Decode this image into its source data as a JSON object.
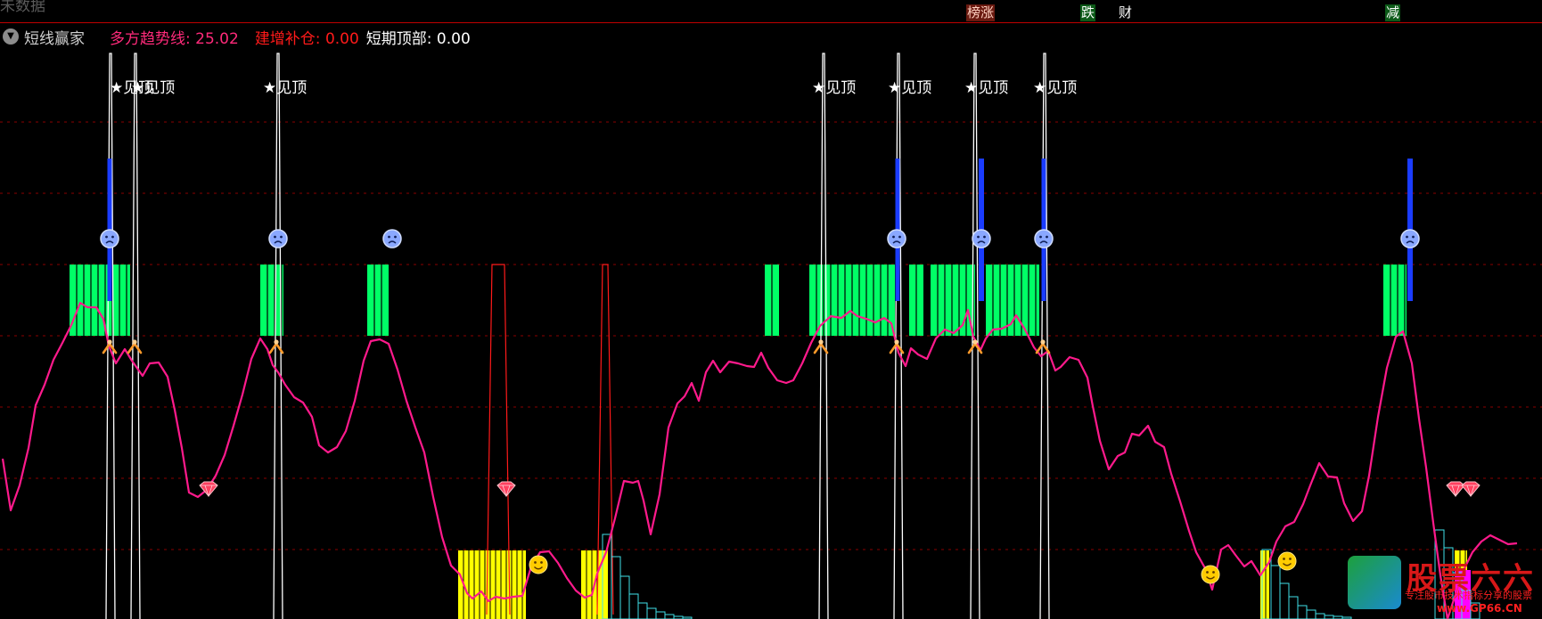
{
  "header": {
    "ghost_text_a": "",
    "ghost_text_b": "未数据",
    "tags": [
      {
        "label": "榜涨"
      },
      {
        "label": "跌"
      },
      {
        "label": "财"
      },
      {
        "label": "减"
      }
    ]
  },
  "indicator": {
    "name": "短线赢家",
    "trend_label": "多方趋势线: 25.02",
    "add_label": "建增补仓: 0.00",
    "top_label": "短期顶部: 0.00"
  },
  "annotations": {
    "top_signal_text": "★见顶",
    "top_signal_x": [
      136,
      160,
      308,
      924,
      1009,
      1095,
      1172
    ]
  },
  "watermark": {
    "main": "股票六六",
    "sub": "专注股市技术指标分享的股票",
    "url": "www.GP66.CN"
  },
  "colors": {
    "trend_line": "#ff1a8c",
    "green_zone": "#00ff66",
    "yellow_zone": "#ffff00",
    "cyan_bars": "#40e0e8",
    "blue_bars": "#1a3cff",
    "grid": "#8a0000"
  },
  "chart_data": {
    "type": "line",
    "series": [
      {
        "values": [
          [
            3,
            515
          ],
          [
            12,
            573
          ],
          [
            22,
            545
          ],
          [
            32,
            503
          ],
          [
            40,
            455
          ],
          [
            50,
            432
          ],
          [
            60,
            404
          ],
          [
            70,
            385
          ],
          [
            80,
            365
          ],
          [
            90,
            340
          ],
          [
            98,
            345
          ],
          [
            108,
            345
          ],
          [
            116,
            358
          ],
          [
            122,
            388
          ],
          [
            130,
            408
          ],
          [
            140,
            392
          ],
          [
            148,
            405
          ],
          [
            160,
            422
          ],
          [
            168,
            408
          ],
          [
            178,
            407
          ],
          [
            188,
            423
          ],
          [
            196,
            460
          ],
          [
            204,
            503
          ],
          [
            212,
            553
          ],
          [
            222,
            558
          ],
          [
            232,
            550
          ],
          [
            242,
            534
          ],
          [
            252,
            511
          ],
          [
            262,
            478
          ],
          [
            272,
            443
          ],
          [
            282,
            403
          ],
          [
            292,
            380
          ],
          [
            300,
            392
          ],
          [
            306,
            410
          ],
          [
            312,
            418
          ],
          [
            320,
            432
          ],
          [
            330,
            446
          ],
          [
            340,
            452
          ],
          [
            350,
            468
          ],
          [
            358,
            500
          ],
          [
            368,
            508
          ],
          [
            378,
            502
          ],
          [
            388,
            484
          ],
          [
            398,
            450
          ],
          [
            408,
            405
          ],
          [
            416,
            383
          ],
          [
            426,
            381
          ],
          [
            436,
            386
          ],
          [
            446,
            415
          ],
          [
            456,
            450
          ],
          [
            466,
            480
          ],
          [
            476,
            508
          ],
          [
            486,
            558
          ],
          [
            496,
            603
          ],
          [
            506,
            635
          ],
          [
            516,
            645
          ],
          [
            524,
            666
          ],
          [
            530,
            672
          ],
          [
            540,
            664
          ],
          [
            548,
            675
          ],
          [
            556,
            670
          ],
          [
            566,
            672
          ],
          [
            576,
            670
          ],
          [
            586,
            669
          ],
          [
            596,
            636
          ],
          [
            606,
            620
          ],
          [
            616,
            619
          ],
          [
            626,
            632
          ],
          [
            636,
            649
          ],
          [
            646,
            663
          ],
          [
            656,
            671
          ],
          [
            664,
            668
          ],
          [
            670,
            644
          ],
          [
            680,
            620
          ],
          [
            690,
            582
          ],
          [
            700,
            540
          ],
          [
            710,
            542
          ],
          [
            716,
            540
          ],
          [
            722,
            562
          ],
          [
            730,
            600
          ],
          [
            740,
            555
          ],
          [
            750,
            480
          ],
          [
            760,
            453
          ],
          [
            768,
            445
          ],
          [
            776,
            430
          ],
          [
            784,
            450
          ],
          [
            792,
            418
          ],
          [
            800,
            405
          ],
          [
            808,
            418
          ],
          [
            818,
            406
          ],
          [
            828,
            408
          ],
          [
            838,
            411
          ],
          [
            846,
            412
          ],
          [
            854,
            396
          ],
          [
            862,
            413
          ],
          [
            872,
            427
          ],
          [
            882,
            430
          ],
          [
            890,
            427
          ],
          [
            900,
            408
          ],
          [
            910,
            385
          ],
          [
            920,
            366
          ],
          [
            932,
            355
          ],
          [
            944,
            357
          ],
          [
            954,
            349
          ],
          [
            962,
            355
          ],
          [
            972,
            358
          ],
          [
            982,
            362
          ],
          [
            992,
            357
          ],
          [
            1000,
            363
          ],
          [
            1008,
            396
          ],
          [
            1016,
            411
          ],
          [
            1022,
            391
          ],
          [
            1030,
            398
          ],
          [
            1040,
            403
          ],
          [
            1050,
            380
          ],
          [
            1060,
            370
          ],
          [
            1070,
            374
          ],
          [
            1080,
            365
          ],
          [
            1086,
            348
          ],
          [
            1092,
            378
          ],
          [
            1100,
            393
          ],
          [
            1106,
            380
          ],
          [
            1114,
            370
          ],
          [
            1124,
            369
          ],
          [
            1134,
            364
          ],
          [
            1140,
            354
          ],
          [
            1150,
            370
          ],
          [
            1160,
            390
          ],
          [
            1168,
            400
          ],
          [
            1176,
            394
          ],
          [
            1184,
            416
          ],
          [
            1190,
            412
          ],
          [
            1200,
            401
          ],
          [
            1210,
            404
          ],
          [
            1220,
            424
          ],
          [
            1226,
            456
          ],
          [
            1234,
            495
          ],
          [
            1244,
            527
          ],
          [
            1254,
            512
          ],
          [
            1262,
            508
          ],
          [
            1270,
            487
          ],
          [
            1278,
            489
          ],
          [
            1288,
            478
          ],
          [
            1296,
            496
          ],
          [
            1306,
            502
          ],
          [
            1314,
            532
          ],
          [
            1324,
            563
          ],
          [
            1334,
            596
          ],
          [
            1342,
            620
          ],
          [
            1352,
            638
          ],
          [
            1360,
            662
          ],
          [
            1370,
            617
          ],
          [
            1378,
            612
          ],
          [
            1386,
            623
          ],
          [
            1396,
            636
          ],
          [
            1404,
            630
          ],
          [
            1414,
            646
          ],
          [
            1424,
            631
          ],
          [
            1432,
            608
          ],
          [
            1442,
            591
          ],
          [
            1452,
            586
          ],
          [
            1462,
            566
          ],
          [
            1470,
            545
          ],
          [
            1480,
            520
          ],
          [
            1490,
            535
          ],
          [
            1500,
            536
          ],
          [
            1508,
            565
          ],
          [
            1518,
            585
          ],
          [
            1528,
            574
          ],
          [
            1536,
            534
          ],
          [
            1546,
            468
          ],
          [
            1556,
            413
          ],
          [
            1566,
            378
          ],
          [
            1574,
            372
          ],
          [
            1584,
            408
          ],
          [
            1592,
            470
          ],
          [
            1600,
            525
          ],
          [
            1608,
            587
          ],
          [
            1616,
            646
          ],
          [
            1624,
            695
          ],
          [
            1642,
            640
          ],
          [
            1652,
            620
          ],
          [
            1662,
            608
          ],
          [
            1672,
            601
          ],
          [
            1682,
            606
          ],
          [
            1692,
            611
          ],
          [
            1702,
            610
          ]
        ]
      }
    ],
    "grid_y": [
      137,
      217,
      297,
      377,
      457,
      537,
      617
    ],
    "green_blocks": [
      {
        "x1": 78,
        "x2": 146
      },
      {
        "x1": 292,
        "x2": 318
      },
      {
        "x1": 412,
        "x2": 436
      },
      {
        "x1": 858,
        "x2": 874
      },
      {
        "x1": 908,
        "x2": 1004
      },
      {
        "x1": 1020,
        "x2": 1036
      },
      {
        "x1": 1044,
        "x2": 1094
      },
      {
        "x1": 1106,
        "x2": 1166
      },
      {
        "x1": 1552,
        "x2": 1578
      }
    ],
    "yellow_blocks": [
      {
        "x1": 514,
        "x2": 590,
        "top": 618
      },
      {
        "x1": 652,
        "x2": 682,
        "top": 618
      },
      {
        "x1": 1414,
        "x2": 1424,
        "top": 618
      },
      {
        "x1": 1632,
        "x2": 1646,
        "top": 618
      }
    ],
    "white_spikes": [
      124,
      152,
      312,
      924,
      1008,
      1094,
      1172
    ],
    "red_spikes": [
      {
        "x1": 546,
        "x2": 572,
        "base": 690,
        "top": 297
      },
      {
        "x1": 670,
        "x2": 688,
        "base": 690,
        "top": 297
      }
    ],
    "blue_bars": [
      {
        "x": 123,
        "y1": 178,
        "y2": 338,
        "w": 5
      },
      {
        "x": 1007,
        "y1": 178,
        "y2": 338,
        "w": 5
      },
      {
        "x": 1101,
        "y1": 178,
        "y2": 338,
        "w": 6
      },
      {
        "x": 1171,
        "y1": 178,
        "y2": 338,
        "w": 5
      },
      {
        "x": 1582,
        "y1": 178,
        "y2": 338,
        "w": 6
      }
    ],
    "sad_faces": [
      [
        123,
        268
      ],
      [
        312,
        268
      ],
      [
        440,
        268
      ],
      [
        1006,
        268
      ],
      [
        1101,
        268
      ],
      [
        1171,
        268
      ],
      [
        1582,
        268
      ]
    ],
    "happy_faces": [
      [
        604,
        634
      ],
      [
        1358,
        645
      ],
      [
        1444,
        630
      ]
    ],
    "diamonds": [
      [
        234,
        549
      ],
      [
        568,
        549
      ],
      [
        1633,
        549
      ],
      [
        1650,
        549
      ]
    ],
    "markers": [
      [
        123,
        390
      ],
      [
        151,
        390
      ],
      [
        310,
        390
      ],
      [
        921,
        390
      ],
      [
        1006,
        390
      ],
      [
        1094,
        390
      ],
      [
        1170,
        390
      ]
    ],
    "cyan_steps": [
      {
        "x0": 676,
        "heights": [
          95,
          70,
          48,
          28,
          18,
          12,
          8,
          5,
          3,
          2
        ]
      },
      {
        "x0": 1416,
        "heights": [
          78,
          60,
          40,
          25,
          15,
          10,
          6,
          4,
          3,
          2
        ]
      },
      {
        "x0": 1610,
        "heights": [
          100,
          80,
          52,
          32,
          18
        ]
      }
    ],
    "magenta_bars": [
      {
        "x": 1632,
        "w": 18,
        "top": 640
      }
    ]
  }
}
